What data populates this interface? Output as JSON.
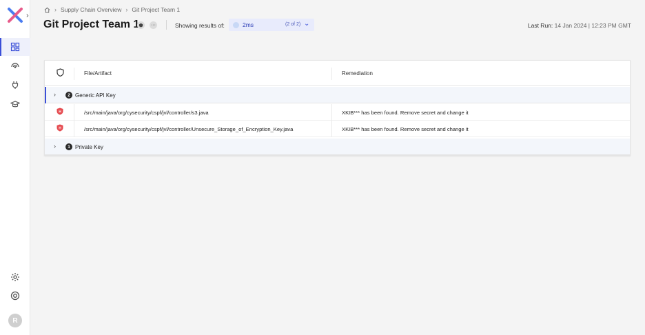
{
  "breadcrumb": {
    "home_icon": "home-icon",
    "items": [
      "Supply Chain Overview",
      "Git Project Team 1"
    ]
  },
  "header": {
    "title": "Git Project Team 1",
    "showing_label": "Showing results of:",
    "selected_result": "2ms",
    "result_count": "(2 of 2)",
    "last_run_label": "Last Run:",
    "last_run_value": "14 Jan 2024 | 12:23 PM GMT"
  },
  "sidebar": {
    "avatar_initial": "R",
    "items": [
      {
        "icon": "dashboard-icon",
        "active": true
      },
      {
        "icon": "signal-icon",
        "active": false
      },
      {
        "icon": "plug-icon",
        "active": false
      },
      {
        "icon": "graduation-cap-icon",
        "active": false
      }
    ],
    "bottom_items": [
      {
        "icon": "gear-icon"
      },
      {
        "icon": "help-icon"
      }
    ]
  },
  "table": {
    "columns": [
      "File/Artifact",
      "Remediation"
    ],
    "groups": [
      {
        "count": "2",
        "name": "Generic API Key",
        "expanded": true,
        "rows": [
          {
            "file": "/src/main/java/org/cysecurity/cspf/jvl/controller/s3.java",
            "remediation": "XKIB*** has been found. Remove secret and change it"
          },
          {
            "file": "/src/main/java/org/cysecurity/cspf/jvl/controller/Unsecure_Storage_of_Encryption_Key.java",
            "remediation": "XKIB*** has been found. Remove secret and change it"
          }
        ]
      },
      {
        "count": "1",
        "name": "Private Key",
        "expanded": false,
        "rows": []
      }
    ]
  },
  "colors": {
    "accent": "#3b4fd8",
    "severity_high": "#e5484d",
    "select_bg": "#e8ebfc"
  }
}
